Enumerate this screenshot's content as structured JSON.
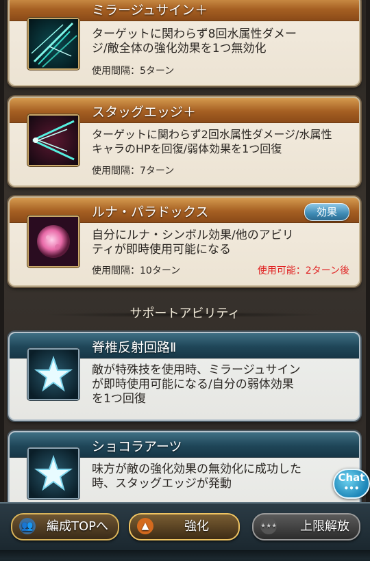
{
  "abilities": [
    {
      "title": "ミラージュサイン＋",
      "desc_line1": "ターゲットに関わらず8回水属性ダメー",
      "desc_line2": "ジ/敵全体の強化効果を1つ無効化",
      "interval": "使用間隔：5ターン",
      "icon": "mirage-sign-icon",
      "accent": "#2fe0c8"
    },
    {
      "title": "スタッグエッジ＋",
      "desc_line1": "ターゲットに関わらず2回水属性ダメージ/水属性",
      "desc_line2": "キャラのHPを回復/弱体効果を1つ回復",
      "interval": "使用間隔：7ターン",
      "icon": "stag-edge-icon",
      "accent": "#2fe0c8"
    },
    {
      "title": "ルナ・パラドックス",
      "effect_button": "効果",
      "desc_line1": "自分にルナ・シンボル効果/他のアビリ",
      "desc_line2": "ティが即時使用可能になる",
      "interval": "使用間隔：10ターン",
      "available": "使用可能：2ターン後",
      "icon": "luna-paradox-icon",
      "accent": "#f080c0"
    }
  ],
  "support_section_label": "サポートアビリティ",
  "support": [
    {
      "title": "脊椎反射回路Ⅱ",
      "desc_line1": "敵が特殊技を使用時、ミラージュサイン",
      "desc_line2": "が即時使用可能になる/自分の弱体効果",
      "desc_line3": "を1つ回復",
      "icon": "star-icon"
    },
    {
      "title": "ショコラアーツ",
      "desc_line1": "味方が敵の強化効果の無効化に成功した",
      "desc_line2": "時、スタッグエッジが発動",
      "icon": "star-icon"
    }
  ],
  "chat_badge": "Chat",
  "bottom_bar": {
    "formation_top": "編成TOPへ",
    "enhance": "強化",
    "limit_break": "上限解放"
  },
  "colors": {
    "header_orange": "#a55f22",
    "header_blue": "#1f4658",
    "available_red": "#e02020"
  }
}
